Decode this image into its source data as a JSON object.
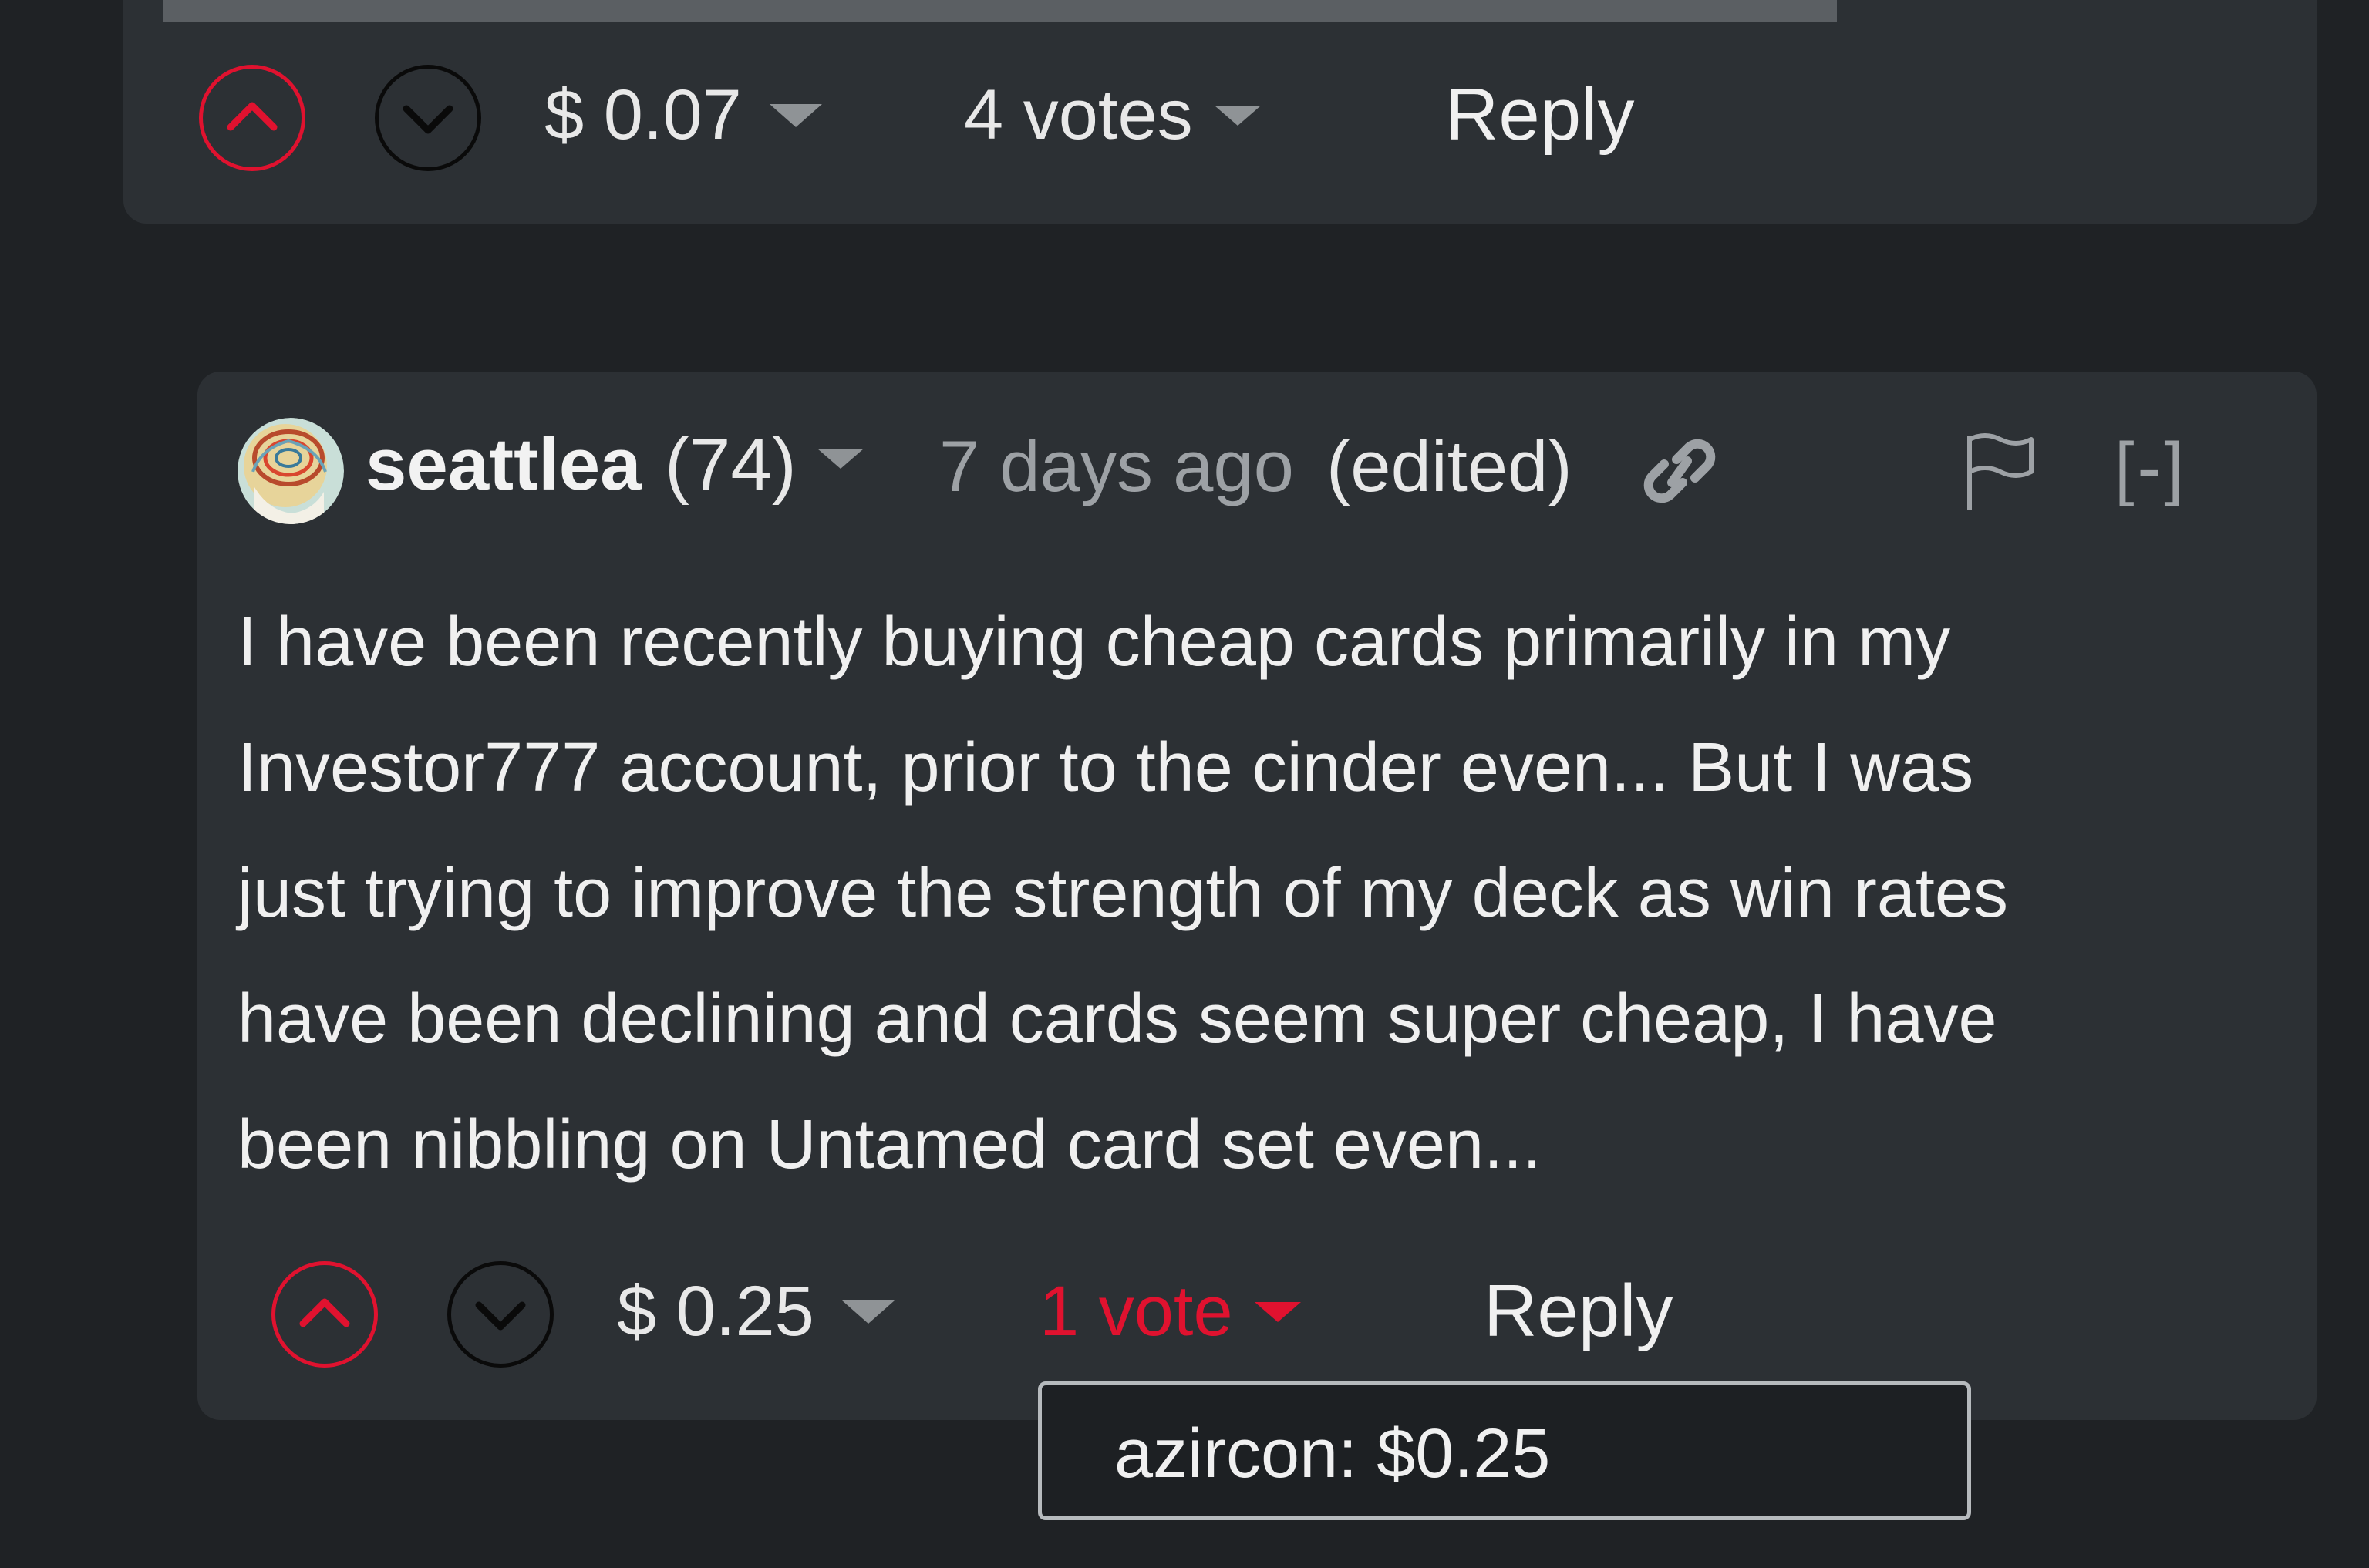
{
  "top_comment": {
    "payout": "$ 0.07",
    "votes": "4 votes",
    "reply": "Reply"
  },
  "comment": {
    "author": "seattlea",
    "reputation": "(74)",
    "timestamp": "7 days ago",
    "edited": "(edited)",
    "collapse": "[-]",
    "body_lines": [
      "I have been recently buying cheap cards primarily in my",
      "Investor777 account, prior to the cinder even... But I was",
      "just trying to improve the strength of my deck as win rates",
      "have been declining and cards seem super cheap, I have",
      "been nibbling on Untamed card set even..."
    ],
    "payout": "$ 0.25",
    "votes": "1 vote",
    "reply": "Reply"
  },
  "tooltip": {
    "text": "azircon: $0.25"
  },
  "colors": {
    "background": "#1f2225",
    "card": "#2c3034",
    "accent_red": "#e0122f",
    "muted": "#9da1a5"
  },
  "icons": {
    "upvote": "chevron-up-circle-icon",
    "downvote": "chevron-down-circle-icon",
    "permalink": "link-icon",
    "flag": "flag-icon"
  }
}
